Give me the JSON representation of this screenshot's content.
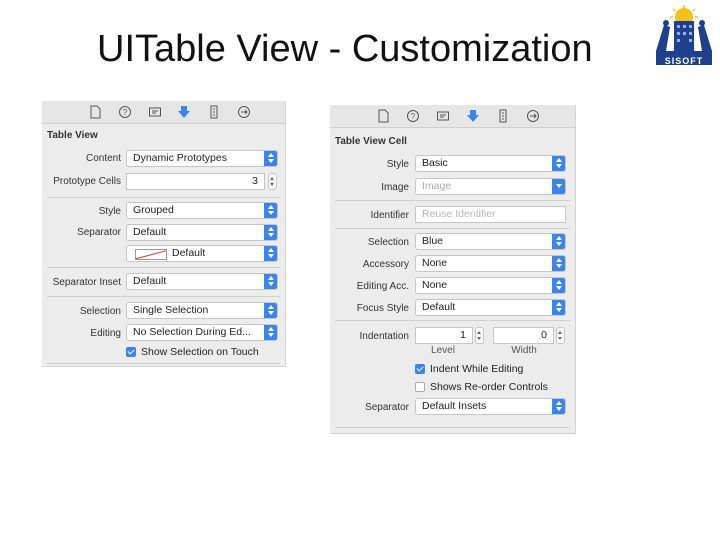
{
  "slide": {
    "title": "UITable View - Customization",
    "logo_text": "SISOFT"
  },
  "colors": {
    "accent": "#3b84e8",
    "panel_bg": "#ececec"
  },
  "toolbar_icons": [
    "file-icon",
    "help-icon",
    "identity-icon",
    "attributes-icon",
    "size-icon",
    "connections-icon"
  ],
  "table_view": {
    "section_title": "Table View",
    "content_label": "Content",
    "content_value": "Dynamic Prototypes",
    "prototype_cells_label": "Prototype Cells",
    "prototype_cells_value": "3",
    "style_label": "Style",
    "style_value": "Grouped",
    "separator_label": "Separator",
    "separator_value": "Default",
    "separator_color_value": "Default",
    "separator_inset_label": "Separator Inset",
    "separator_inset_value": "Default",
    "selection_label": "Selection",
    "selection_value": "Single Selection",
    "editing_label": "Editing",
    "editing_value": "No Selection During Ed...",
    "show_selection_label": "Show Selection on Touch",
    "show_selection_checked": true
  },
  "table_view_cell": {
    "section_title": "Table View Cell",
    "style_label": "Style",
    "style_value": "Basic",
    "image_label": "Image",
    "image_placeholder": "Image",
    "identifier_label": "Identifier",
    "identifier_placeholder": "Reuse Identifier",
    "selection_label": "Selection",
    "selection_value": "Blue",
    "accessory_label": "Accessory",
    "accessory_value": "None",
    "editing_acc_label": "Editing Acc.",
    "editing_acc_value": "None",
    "focus_style_label": "Focus Style",
    "focus_style_value": "Default",
    "indentation_label": "Indentation",
    "indentation_level_value": "1",
    "indentation_width_value": "0",
    "level_label": "Level",
    "width_label": "Width",
    "indent_while_editing_label": "Indent While Editing",
    "indent_while_editing_checked": true,
    "shows_reorder_label": "Shows Re-order Controls",
    "shows_reorder_checked": false,
    "separator_label": "Separator",
    "separator_value": "Default Insets"
  }
}
